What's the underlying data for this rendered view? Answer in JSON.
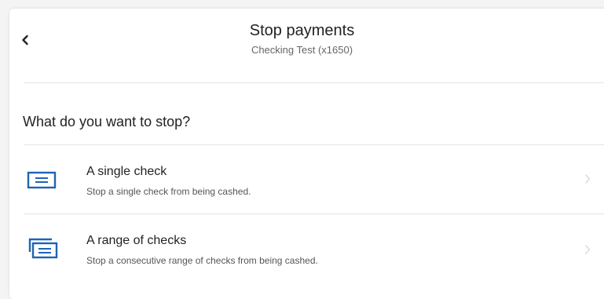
{
  "header": {
    "title": "Stop payments",
    "subtitle": "Checking Test (x1650)",
    "back_icon": "chevron-left-icon"
  },
  "section": {
    "heading": "What do you want to stop?"
  },
  "options": [
    {
      "title": "A single check",
      "description": "Stop a single check from being cashed.",
      "icon": "single-check-icon"
    },
    {
      "title": "A range of checks",
      "description": "Stop a consecutive range of checks from being cashed.",
      "icon": "multiple-checks-icon"
    }
  ],
  "colors": {
    "accent": "#1f63b5",
    "text": "#222222",
    "muted": "#666666",
    "divider": "#e4e4e4"
  }
}
